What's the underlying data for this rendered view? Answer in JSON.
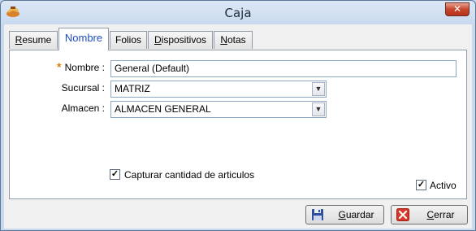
{
  "window": {
    "title": "Caja",
    "icon": "app-icon"
  },
  "tabs": [
    {
      "label": "Resume",
      "mnemonic": "R",
      "rest": "esume"
    },
    {
      "label": "Nombre"
    },
    {
      "label": "Folios"
    },
    {
      "label": "Dispositivos",
      "mnemonic": "D",
      "rest": "ispositivos"
    },
    {
      "label": "Notas",
      "mnemonic": "N",
      "rest": "otas"
    }
  ],
  "form": {
    "nombre_label": "Nombre :",
    "nombre_value": "General (Default)",
    "sucursal_label": "Sucursal :",
    "sucursal_value": "MATRIZ",
    "almacen_label": "Almacen :",
    "almacen_value": "ALMACEN GENERAL",
    "capturar_label": "Capturar cantidad de articulos",
    "capturar_checked": true,
    "activo_label": "Activo",
    "activo_checked": true
  },
  "buttons": {
    "guardar": {
      "label": "Guardar",
      "mnemonic": "G",
      "rest": "uardar"
    },
    "cerrar": {
      "label": "Cerrar",
      "mnemonic": "C",
      "rest": "errar"
    }
  },
  "colors": {
    "accent": "#1f4fc2",
    "required": "#e07b12",
    "close": "#c8452c"
  }
}
